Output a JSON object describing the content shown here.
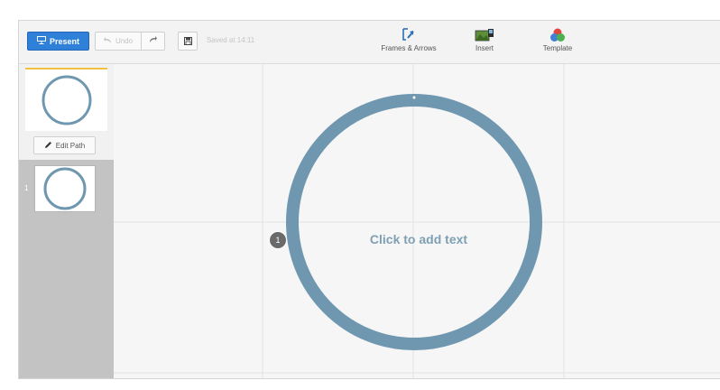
{
  "toolbar": {
    "present_label": "Present",
    "undo_label": "Undo",
    "saved_text": "Saved at 14:11",
    "tools": {
      "frames_label": "Frames & Arrows",
      "insert_label": "Insert",
      "template_label": "Template"
    }
  },
  "sidebar": {
    "edit_path_label": "Edit Path",
    "steps": [
      {
        "number": "1"
      }
    ]
  },
  "canvas": {
    "placeholder_text": "Click to add text",
    "path_badge": "1"
  },
  "colors": {
    "accent": "#2f80d8",
    "circle_stroke": "#6f98b0",
    "template_red": "#e0463d",
    "template_blue": "#3f7fd6",
    "template_green": "#4caf50"
  },
  "icons": {
    "present": "projector-icon",
    "undo": "undo-arrow-icon",
    "redo": "redo-arrow-icon",
    "save": "floppy-disk-icon",
    "frames": "frames-arrows-icon",
    "insert": "insert-image-icon",
    "template": "palette-icon",
    "edit_path": "pencil-icon"
  }
}
